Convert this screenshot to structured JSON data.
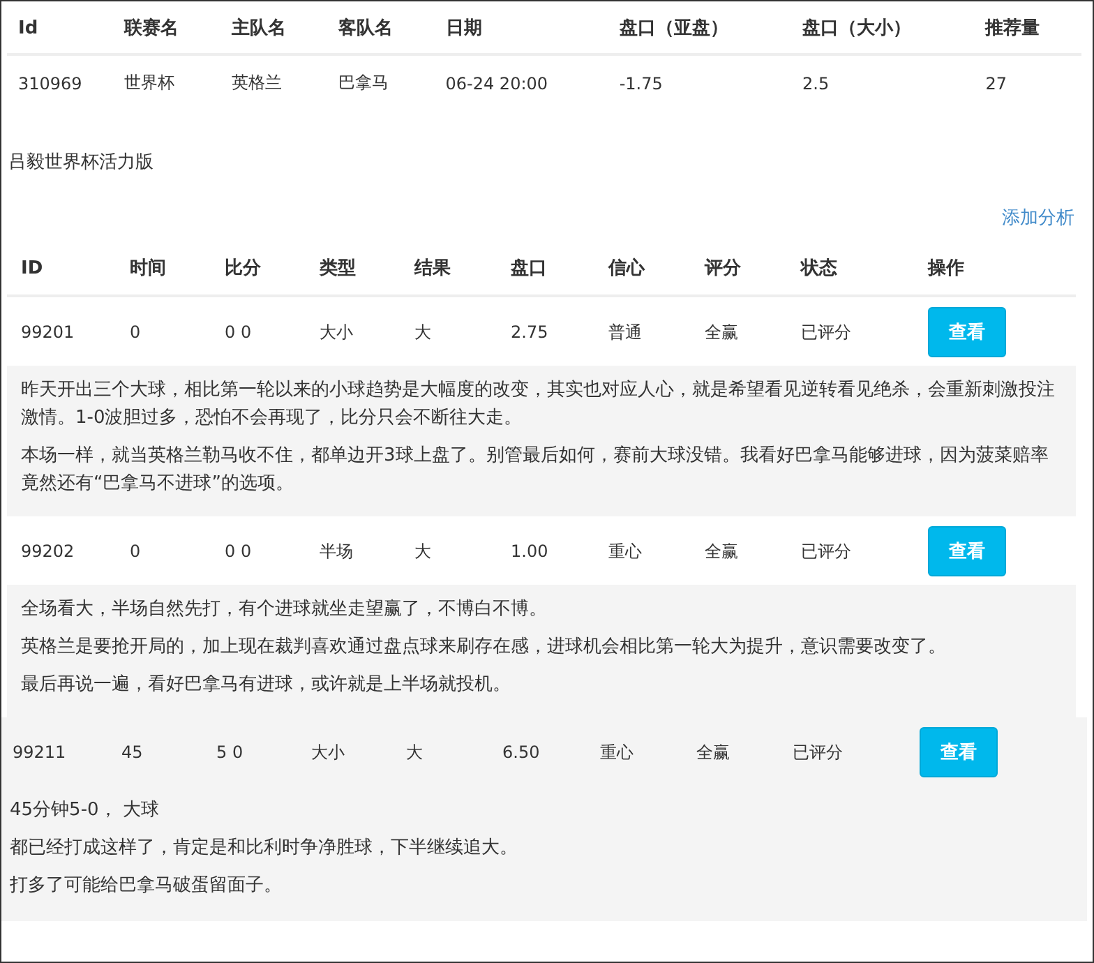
{
  "match_table": {
    "columns": [
      "Id",
      "联赛名",
      "主队名",
      "客队名",
      "日期",
      "盘口（亚盘）",
      "盘口（大小）",
      "推荐量"
    ],
    "rows": [
      [
        "310969",
        "世界杯",
        "英格兰",
        "巴拿马",
        "06-24 20:00",
        "-1.75",
        "2.5",
        "27"
      ]
    ]
  },
  "author": "吕毅世界杯活力版",
  "add_link": "添加分析",
  "analysis_table": {
    "columns": [
      "ID",
      "时间",
      "比分",
      "类型",
      "结果",
      "盘口",
      "信心",
      "评分",
      "状态",
      "操作"
    ],
    "rows": [
      {
        "kind": "plain",
        "cells": [
          "99201",
          "0",
          "0 0",
          "大小",
          "大",
          "2.75",
          "普通",
          "全赢",
          "已评分"
        ],
        "button": "查看",
        "notes": [
          "昨天开出三个大球，相比第一轮以来的小球趋势是大幅度的改变，其实也对应人心，就是希望看见逆转看见绝杀，会重新刺激投注激情。1-0波胆过多，恐怕不会再现了，比分只会不断往大走。",
          "本场一样，就当英格兰勒马收不住，都单边开3球上盘了。别管最后如何，赛前大球没错。我看好巴拿马能够进球，因为菠菜赔率竟然还有“巴拿马不进球”的选项。"
        ]
      },
      {
        "kind": "plain",
        "cells": [
          "99202",
          "0",
          "0 0",
          "半场",
          "大",
          "1.00",
          "重心",
          "全赢",
          "已评分"
        ],
        "button": "查看",
        "notes": [
          "全场看大，半场自然先打，有个进球就坐走望赢了，不博白不博。",
          "英格兰是要抢开局的，加上现在裁判喜欢通过盘点球来刷存在感，进球机会相比第一轮大为提升，意识需要改变了。",
          "最后再说一遍，看好巴拿马有进球，或许就是上半场就投机。"
        ]
      },
      {
        "kind": "shaded",
        "cells": [
          "99211",
          "45",
          "5 0",
          "大小",
          "大",
          "6.50",
          "重心",
          "全赢",
          "已评分"
        ],
        "button": "查看",
        "notes": [
          "45分钟5-0， 大球",
          "都已经打成这样了，肯定是和比利时争净胜球，下半继续追大。",
          "打多了可能给巴拿马破蛋留面子。"
        ]
      }
    ]
  }
}
